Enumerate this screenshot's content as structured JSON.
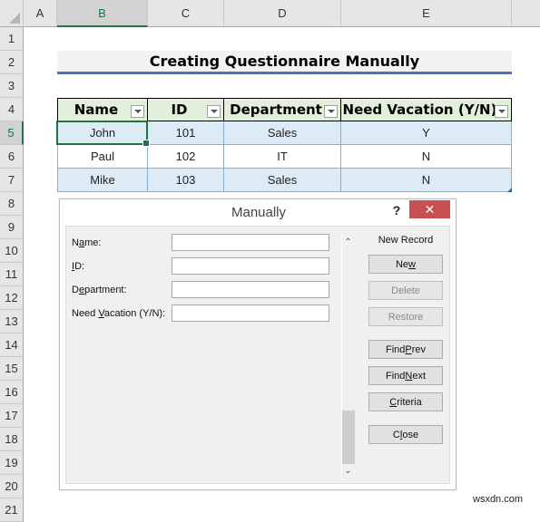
{
  "spreadsheet": {
    "columns": [
      "A",
      "B",
      "C",
      "D",
      "E"
    ],
    "selected_column": "B",
    "rows": [
      "1",
      "2",
      "3",
      "4",
      "5",
      "6",
      "7",
      "8",
      "9",
      "10",
      "11",
      "12",
      "13",
      "14",
      "15",
      "16",
      "17",
      "18",
      "19",
      "20",
      "21"
    ],
    "selected_row": "5",
    "title": "Creating Questionnaire Manually",
    "table": {
      "headers": [
        "Name",
        "ID",
        "Department",
        "Need Vacation (Y/N)"
      ],
      "rows": [
        [
          "John",
          "101",
          "Sales",
          "Y"
        ],
        [
          "Paul",
          "102",
          "IT",
          "N"
        ],
        [
          "Mike",
          "103",
          "Sales",
          "N"
        ]
      ]
    }
  },
  "dialog": {
    "title": "Manually",
    "help_label": "?",
    "close_label": "✕",
    "record_label": "New Record",
    "fields": [
      {
        "pre": "N",
        "acc": "a",
        "post": "me:",
        "value": ""
      },
      {
        "pre": "",
        "acc": "I",
        "post": "D:",
        "value": ""
      },
      {
        "pre": "D",
        "acc": "e",
        "post": "partment:",
        "value": ""
      },
      {
        "pre": "Need ",
        "acc": "V",
        "post": "acation (Y/N):",
        "value": ""
      }
    ],
    "buttons": [
      {
        "pre": "Ne",
        "acc": "w",
        "post": "",
        "disabled": false
      },
      {
        "pre": "",
        "acc": "",
        "post": "Delete",
        "disabled": true
      },
      {
        "pre": "",
        "acc": "",
        "post": "Restore",
        "disabled": true
      },
      {
        "pre": "Find ",
        "acc": "P",
        "post": "rev",
        "disabled": false
      },
      {
        "pre": "Find ",
        "acc": "N",
        "post": "ext",
        "disabled": false
      },
      {
        "pre": "",
        "acc": "C",
        "post": "riteria",
        "disabled": false
      },
      {
        "pre": "C",
        "acc": "l",
        "post": "ose",
        "disabled": false
      }
    ],
    "scroll_up": "⌃",
    "scroll_down": "⌄"
  },
  "watermark": "wsxdn.com"
}
